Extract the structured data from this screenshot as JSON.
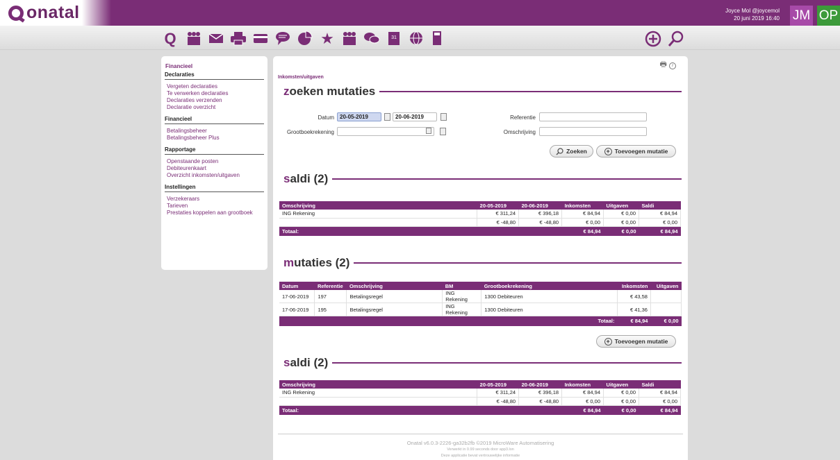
{
  "app": {
    "logo": "onatal"
  },
  "user": {
    "line1": "Joyce Mol @joycemol",
    "line2": "20 juni 2019 16:40",
    "initials_jm": "JM",
    "initials_op": "OP"
  },
  "toolbar": {
    "icons": [
      "onatal-icon",
      "people-icon",
      "mail-icon",
      "printer-icon",
      "card-icon",
      "chat-icon",
      "pie-chart-icon",
      "star-icon",
      "group-icon",
      "messages-icon",
      "calendar-icon",
      "globe-icon",
      "calculator-icon",
      "add-icon",
      "search-icon"
    ],
    "calendar_day": "31"
  },
  "sidebar": {
    "title": "Financieel",
    "sections": [
      {
        "head": "Declaraties",
        "items": [
          "Vergeten declaraties",
          "Te verwerken declaraties",
          "Declaraties verzenden",
          "Declaratie overzicht"
        ]
      },
      {
        "head": "Financieel",
        "items": [
          "Betalingsbeheer",
          "Betalingsbeheer Plus"
        ]
      },
      {
        "head": "Rapportage",
        "items": [
          "Openstaande posten",
          "Debiteurenkaart",
          "Overzicht inkomsten/uitgaven"
        ]
      },
      {
        "head": "Instellingen",
        "items": [
          "Verzekeraars",
          "Tarieven",
          "Prestaties koppelen aan grootboek"
        ]
      }
    ]
  },
  "main": {
    "breadcrumb": "Inkomsten/uitgaven",
    "search": {
      "title_first": "z",
      "title_rest": "oeken mutaties",
      "datum_label": "Datum",
      "date_from": "20-05-2019",
      "date_to": "20-06-2019",
      "grootboek_label": "Grootboekrekening",
      "referentie_label": "Referentie",
      "omschrijving_label": "Omschrijving",
      "search_button": "Zoeken",
      "add_button": "Toevoegen mutatie"
    },
    "saldi": {
      "title_first": "s",
      "title_rest": "aldi (2)",
      "headers": [
        "Omschrijving",
        "20-05-2019",
        "20-06-2019",
        "Inkomsten",
        "Uitgaven",
        "Saldi"
      ],
      "rows": [
        [
          "ING Rekening",
          "€ 311,24",
          "€ 396,18",
          "€ 84,94",
          "€ 0,00",
          "€ 84,94"
        ],
        [
          "",
          "€ -48,80",
          "€ -48,80",
          "€ 0,00",
          "€ 0,00",
          "€ 0,00"
        ]
      ],
      "total": {
        "label": "Totaal:",
        "inkomsten": "€ 84,94",
        "uitgaven": "€ 0,00",
        "saldi": "€ 84,94"
      }
    },
    "mutaties": {
      "title_first": "m",
      "title_rest": "utaties (2)",
      "headers": [
        "Datum",
        "Referentie",
        "Omschrijving",
        "BM",
        "Grootboekrekening",
        "Inkomsten",
        "Uitgaven"
      ],
      "rows": [
        [
          "17-06-2019",
          "197",
          "Betalingsregel",
          "ING Rekening",
          "1300 Debiteuren",
          "€ 43,58",
          ""
        ],
        [
          "17-06-2019",
          "195",
          "Betalingsregel",
          "ING Rekening",
          "1300 Debiteuren",
          "€ 41,36",
          ""
        ]
      ],
      "total": {
        "label": "Totaal:",
        "inkomsten": "€ 84,94",
        "uitgaven": "€ 0,00"
      },
      "add_button": "Toevoegen mutatie"
    },
    "footer": {
      "line1": "Onatal v6.0.3-2226-ga32b2fb ©2019 MicroWare Automatisering",
      "line2": "Verwerkt in 0.99 seconds door app3.lon",
      "line3": "Deze applicatie bevat vertrouwelijke informatie"
    }
  }
}
